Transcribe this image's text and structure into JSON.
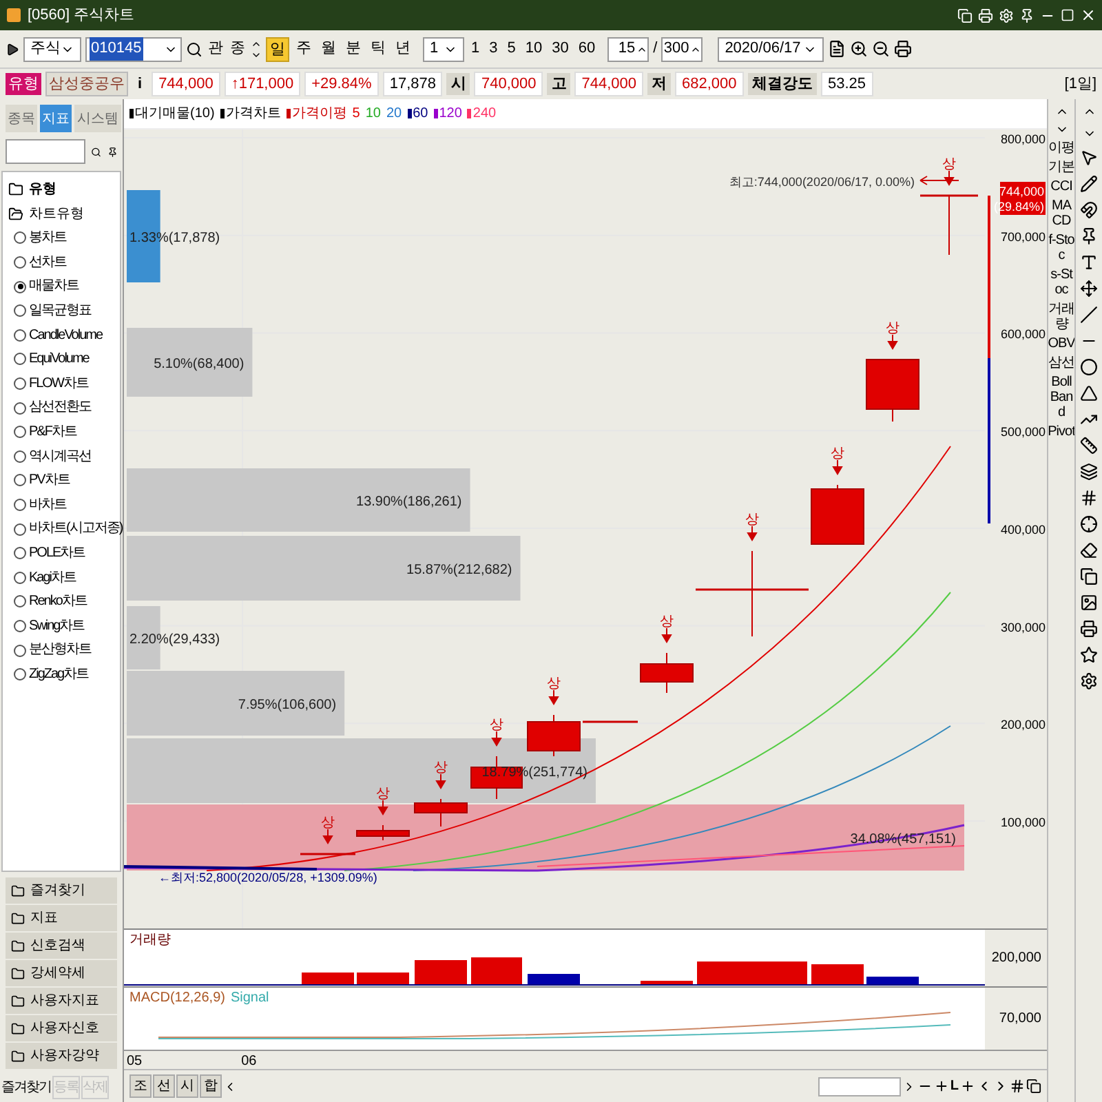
{
  "window": {
    "title": "[0560] 주식차트"
  },
  "toolbar": {
    "market": "주식",
    "code": "010145",
    "lookup_buttons": [
      "관",
      "종"
    ],
    "periods": [
      {
        "label": "일",
        "selected": true
      },
      {
        "label": "주",
        "selected": false
      },
      {
        "label": "월",
        "selected": false
      },
      {
        "label": "분",
        "selected": false
      },
      {
        "label": "틱",
        "selected": false
      },
      {
        "label": "년",
        "selected": false
      }
    ],
    "unit": "1",
    "intervals": [
      "1",
      "3",
      "5",
      "10",
      "30",
      "60"
    ],
    "count": "15",
    "separator": "/",
    "total": "300",
    "date": "2020/06/17"
  },
  "quote": {
    "type_label": "유형",
    "name": "삼성중공우",
    "info": "i",
    "cells": [
      {
        "kind": "value",
        "text": "744,000",
        "color": "#cc0000"
      },
      {
        "kind": "value",
        "text": "↑171,000",
        "color": "#cc0000"
      },
      {
        "kind": "value",
        "text": "+29.84%",
        "color": "#cc0000"
      },
      {
        "kind": "value",
        "text": "17,878",
        "color": "#000000"
      },
      {
        "kind": "label",
        "text": "시"
      },
      {
        "kind": "value",
        "text": "740,000",
        "color": "#cc0000"
      },
      {
        "kind": "label",
        "text": "고"
      },
      {
        "kind": "value",
        "text": "744,000",
        "color": "#cc0000"
      },
      {
        "kind": "label",
        "text": "저"
      },
      {
        "kind": "value",
        "text": "682,000",
        "color": "#cc0000"
      },
      {
        "kind": "label",
        "text": "체결강도"
      },
      {
        "kind": "value",
        "text": "53.25",
        "color": "#000000"
      }
    ],
    "period": "[1일]"
  },
  "sidebar": {
    "tabs": [
      {
        "label": "종목",
        "selected": false
      },
      {
        "label": "지표",
        "selected": true
      },
      {
        "label": "시스템",
        "selected": false
      }
    ],
    "tree": [
      {
        "label": "유형",
        "children": [
          {
            "label": "차트유형",
            "children": [
              {
                "label": "봉차트",
                "selected": false
              },
              {
                "label": "선차트",
                "selected": false
              },
              {
                "label": "매물차트",
                "selected": true
              },
              {
                "label": "일목균형표",
                "selected": false
              },
              {
                "label": "CandleVolume",
                "selected": false
              },
              {
                "label": "EquiVolume",
                "selected": false
              },
              {
                "label": "FLOW차트",
                "selected": false
              },
              {
                "label": "삼선전환도",
                "selected": false
              },
              {
                "label": "P&F차트",
                "selected": false
              },
              {
                "label": "역시계곡선",
                "selected": false
              },
              {
                "label": "PV차트",
                "selected": false
              },
              {
                "label": "바차트",
                "selected": false
              },
              {
                "label": "바차트(시고저종)",
                "selected": false
              },
              {
                "label": "POLE차트",
                "selected": false
              },
              {
                "label": "Kagi차트",
                "selected": false
              },
              {
                "label": "Renko차트",
                "selected": false
              },
              {
                "label": "Swing차트",
                "selected": false
              },
              {
                "label": "분산형차트",
                "selected": false
              },
              {
                "label": "ZigZag차트",
                "selected": false
              }
            ]
          }
        ]
      }
    ],
    "folders": [
      "즐겨찾기",
      "지표",
      "신호검색",
      "강세약세",
      "사용자지표",
      "사용자신호",
      "사용자강약"
    ],
    "footer": {
      "label": "즐겨찾기",
      "buttons": [
        {
          "label": "등록",
          "disabled": true
        },
        {
          "label": "삭제",
          "disabled": true
        }
      ]
    }
  },
  "chart": {
    "legend": [
      {
        "label": "대기매물(10)",
        "color": "#000000"
      },
      {
        "label": "가격차트",
        "color": "#000000"
      },
      {
        "label": "가격이평",
        "color": "#cc0000"
      }
    ],
    "ma_periods": [
      {
        "label": "5",
        "color": "#e00000"
      },
      {
        "label": "10",
        "color": "#22aa22"
      },
      {
        "label": "20",
        "color": "#2277cc"
      },
      {
        "label": "60",
        "color": "#000080"
      },
      {
        "label": "120",
        "color": "#9900cc"
      },
      {
        "label": "240",
        "color": "#ff3366"
      }
    ],
    "y_axis": [
      "800,000",
      "700,000",
      "600,000",
      "500,000",
      "400,000",
      "300,000",
      "200,000",
      "100,000"
    ],
    "price_tag": {
      "price": "744,000",
      "rate": "(29.84%)"
    },
    "high_note": "최고:744,000(2020/06/17, 0.00%)",
    "low_note": "←최저:52,800(2020/05/28, +1309.09%)",
    "volume_profile": [
      {
        "label": "1.33%(17,878)",
        "level": 0.04,
        "color": "#3b8fd0"
      },
      {
        "label": "5.10%(68,400)",
        "level": 0.15,
        "color": "#c8c8c8"
      },
      {
        "label": "13.90%(186,261)",
        "level": 0.41,
        "color": "#c8c8c8"
      },
      {
        "label": "15.87%(212,682)",
        "level": 0.47,
        "color": "#c8c8c8"
      },
      {
        "label": "2.20%(29,433)",
        "level": 0.04,
        "color": "#c8c8c8"
      },
      {
        "label": "7.95%(106,600)",
        "level": 0.26,
        "color": "#c8c8c8"
      },
      {
        "label": "18.79%(251,774)",
        "level": 0.56,
        "color": "#c8c8c8"
      },
      {
        "label": "34.08%(457,151)",
        "level": 1.0,
        "color": "#e8a0a8"
      }
    ],
    "signals": [
      "상",
      "상",
      "상",
      "상",
      "상",
      "상",
      "상",
      "상",
      "상",
      "상"
    ]
  },
  "volume": {
    "title": "거래량",
    "axis": "200,000"
  },
  "macd": {
    "title": "MACD(12,26,9)",
    "signal": "Signal",
    "axis": "70,000"
  },
  "x_axis": [
    "05",
    "06"
  ],
  "side_tools": [
    "이평",
    "기본",
    "CCI",
    "MACD",
    "f-Stoc",
    "s-Stoc",
    "거래량",
    "OBV",
    "삼선",
    "Boll Band",
    "Pivot"
  ],
  "bottom_bar": {
    "tabs": [
      "조",
      "선",
      "시",
      "합"
    ],
    "zoom_label": "L"
  }
}
